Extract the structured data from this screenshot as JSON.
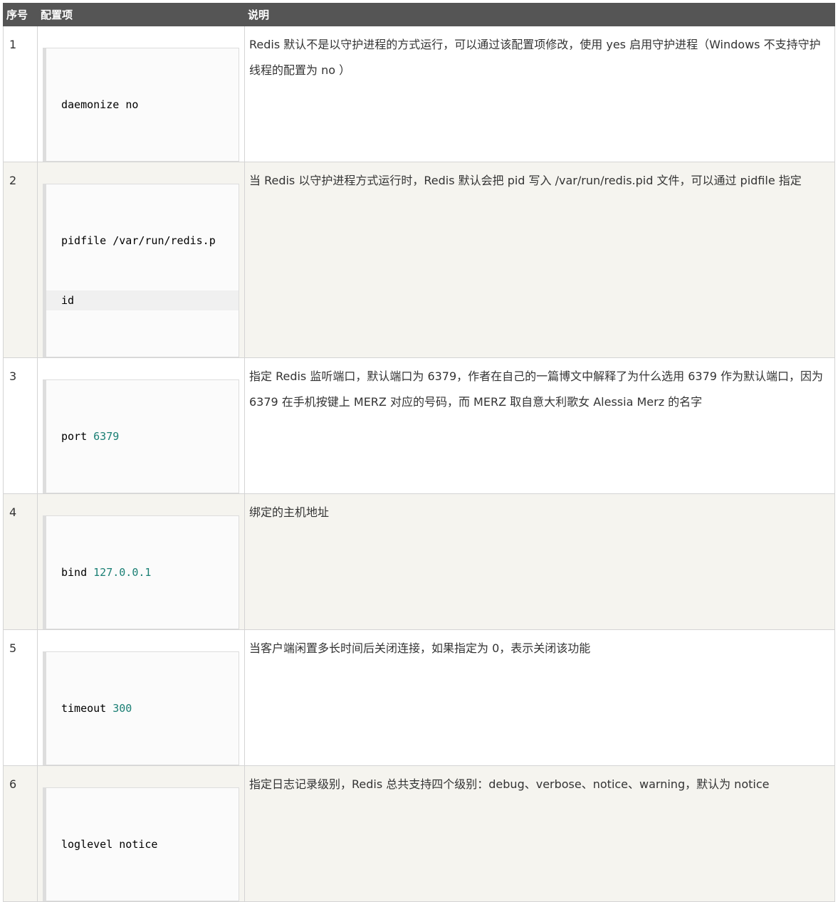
{
  "header": {
    "col_num": "序号",
    "col_item": "配置项",
    "col_desc": "说明"
  },
  "rows": [
    {
      "num": "1",
      "key": "daemonize",
      "value": "no",
      "value_type": "plain",
      "desc": "Redis 默认不是以守护进程的方式运行，可以通过该配置项修改，使用 yes 启用守护进程（Windows 不支持守护线程的配置为 no ）"
    },
    {
      "num": "2",
      "key": "pidfile",
      "value_line1": "/var/run/redis.p",
      "value_line2": "id",
      "value_type": "plain",
      "desc": "当 Redis 以守护进程方式运行时，Redis 默认会把 pid 写入 /var/run/redis.pid 文件，可以通过 pidfile 指定"
    },
    {
      "num": "3",
      "key": "port",
      "value": "6379",
      "value_type": "number",
      "desc": "指定 Redis 监听端口，默认端口为 6379，作者在自己的一篇博文中解释了为什么选用 6379 作为默认端口，因为 6379 在手机按键上 MERZ 对应的号码，而 MERZ 取自意大利歌女 Alessia Merz 的名字"
    },
    {
      "num": "4",
      "key": "bind",
      "value": "127.0.0.1",
      "value_type": "number",
      "desc": "绑定的主机地址"
    },
    {
      "num": "5",
      "key": "timeout",
      "value": "300",
      "value_type": "number",
      "desc": "当客户端闲置多长时间后关闭连接，如果指定为 0，表示关闭该功能"
    },
    {
      "num": "6",
      "key": "loglevel",
      "value": "notice",
      "value_type": "plain",
      "desc": "指定日志记录级别，Redis 总共支持四个级别：debug、verbose、notice、warning，默认为 notice"
    }
  ],
  "colors": {
    "header_bg": "#555555",
    "row_alt_bg": "#f5f4ef",
    "number_value": "#1a7f74"
  }
}
